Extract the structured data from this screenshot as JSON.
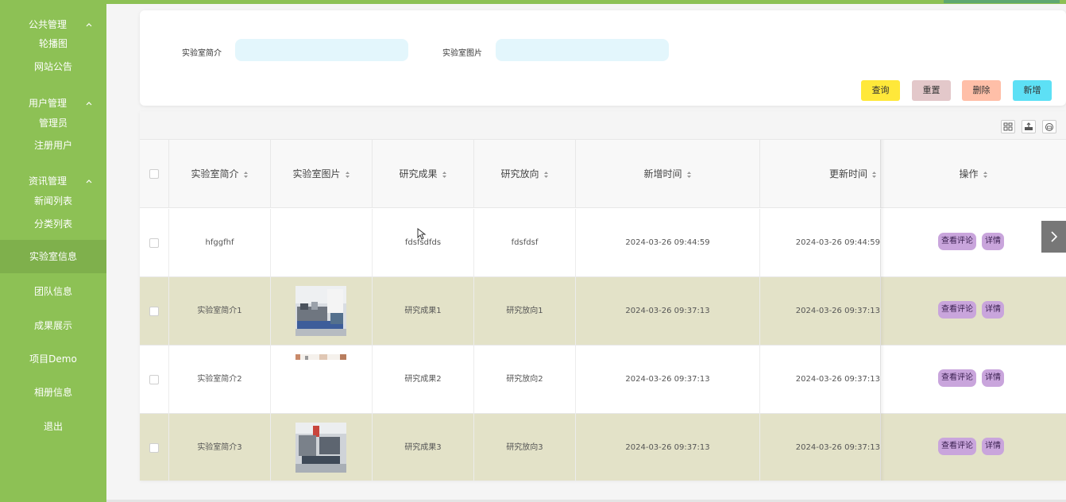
{
  "sidebar": {
    "groups": [
      {
        "title": "公共管理",
        "items": [
          "轮播图",
          "网站公告"
        ]
      },
      {
        "title": "用户管理",
        "items": [
          "管理员",
          "注册用户"
        ]
      },
      {
        "title": "资讯管理",
        "items": [
          "新闻列表",
          "分类列表"
        ]
      }
    ],
    "main_items": [
      "实验室信息",
      "团队信息",
      "成果展示",
      "项目Demo",
      "相册信息",
      "退出"
    ],
    "active_item": "实验室信息",
    "bg_color": "#8dc155",
    "active_color": "#7fb04c"
  },
  "search": {
    "field1_label": "实验室简介",
    "field1_value": "",
    "field2_label": "实验室图片",
    "field2_value": "",
    "buttons": {
      "query": "查询",
      "reset": "重置",
      "delete": "删除",
      "add": "新增"
    },
    "button_colors": {
      "query": "#ffe83a",
      "reset": "#e3c8ca",
      "delete": "#ffbfa8",
      "add": "#5de0f5"
    }
  },
  "toolbar_icons": [
    "columns-icon",
    "export-icon",
    "print-icon"
  ],
  "table": {
    "columns": [
      "实验室简介",
      "实验室图片",
      "研究成果",
      "研究放向",
      "新增时间",
      "更新时间",
      "操作"
    ],
    "rows": [
      {
        "intro": "hfggfhf",
        "image": "",
        "result": "fdsfsdfds",
        "direction": "fdsfdsf",
        "created": "2024-03-26 09:44:59",
        "updated": "2024-03-26 09:44:59"
      },
      {
        "intro": "实验室简介1",
        "image": "lab-photo-1",
        "result": "研究成果1",
        "direction": "研究放向1",
        "created": "2024-03-26 09:37:13",
        "updated": "2024-03-26 09:37:13"
      },
      {
        "intro": "实验室简介2",
        "image": "lab-photo-2",
        "result": "研究成果2",
        "direction": "研究放向2",
        "created": "2024-03-26 09:37:13",
        "updated": "2024-03-26 09:37:13"
      },
      {
        "intro": "实验室简介3",
        "image": "lab-photo-3",
        "result": "研究成果3",
        "direction": "研究放向3",
        "created": "2024-03-26 09:37:13",
        "updated": "2024-03-26 09:37:13"
      }
    ],
    "actions": {
      "comments": "查看评论",
      "detail": "详情"
    },
    "row_alt_color": "#e3e2c8",
    "action_color": "#c9a5dc"
  }
}
